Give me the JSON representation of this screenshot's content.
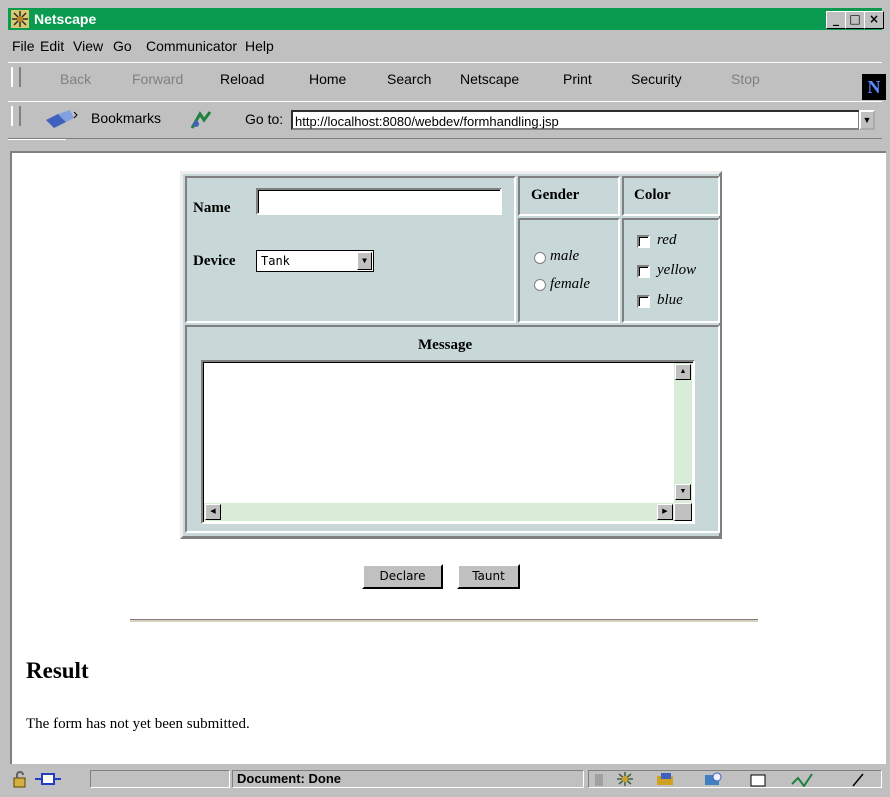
{
  "window": {
    "title": "Netscape",
    "minimize": "_",
    "maximize": "□",
    "close": "×"
  },
  "menu": [
    "File",
    "Edit",
    "View",
    "Go",
    "Communicator",
    "Help"
  ],
  "nav_buttons": [
    {
      "label": "Back",
      "enabled": false
    },
    {
      "label": "Forward",
      "enabled": false
    },
    {
      "label": "Reload",
      "enabled": true
    },
    {
      "label": "Home",
      "enabled": true
    },
    {
      "label": "Search",
      "enabled": true
    },
    {
      "label": "Netscape",
      "enabled": true
    },
    {
      "label": "Print",
      "enabled": true
    },
    {
      "label": "Security",
      "enabled": true
    },
    {
      "label": "Stop",
      "enabled": false
    }
  ],
  "location": {
    "bookmarks_label": "Bookmarks",
    "goto_label": "Go to:",
    "url": "http://localhost:8080/webdev/formhandling.jsp"
  },
  "form": {
    "name_label": "Name",
    "name_value": "",
    "device_label": "Device",
    "device_selected": "Tank",
    "gender_header": "Gender",
    "gender_options": [
      "male",
      "female"
    ],
    "color_header": "Color",
    "color_options": [
      "red",
      "yellow",
      "blue"
    ],
    "message_header": "Message",
    "message_value": ""
  },
  "buttons": {
    "declare": "Declare",
    "taunt": "Taunt"
  },
  "result": {
    "heading": "Result",
    "text": "The form has not yet been submitted."
  },
  "statusbar": {
    "text": "Document: Done"
  },
  "colors": {
    "titlebar": "#0a9a50",
    "form_bg": "#c8d8d8",
    "scroll_track": "#d8ecd8"
  },
  "icons": [
    "netscape-logo-icon",
    "bookmarks-icon",
    "location-icon",
    "security-lock-icon",
    "connection-icon",
    "component-icons"
  ]
}
